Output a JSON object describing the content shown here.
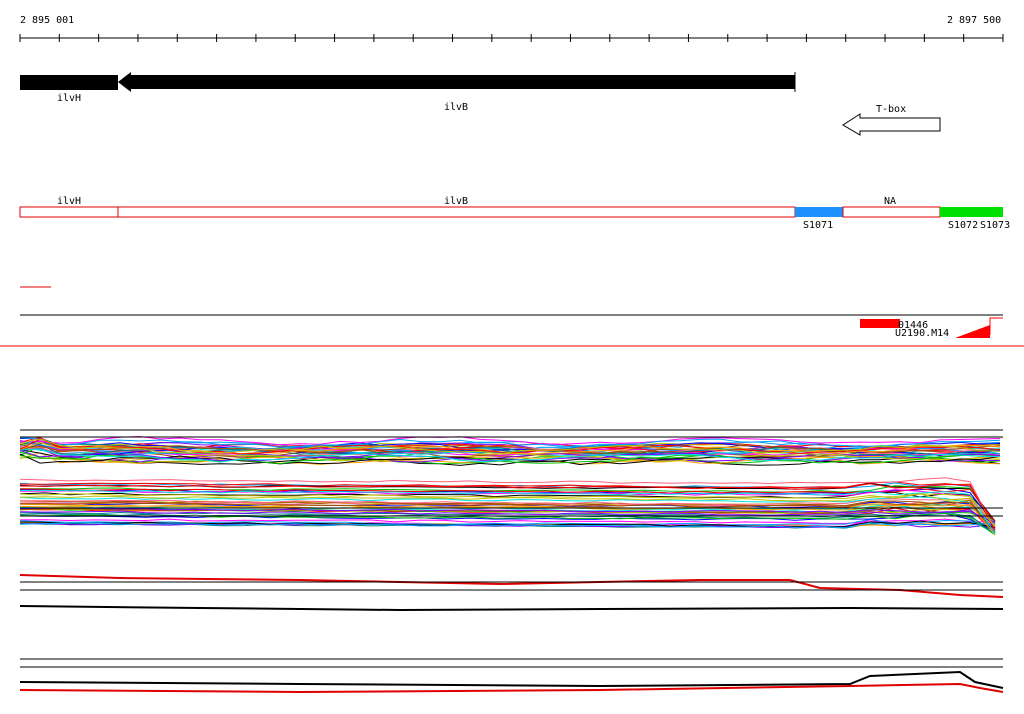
{
  "ruler": {
    "start_label": "2 895 001",
    "end_label": "2 897 500"
  },
  "genes": [
    {
      "name": "ilvH",
      "label": "ilvH",
      "strand": "-"
    },
    {
      "name": "ilvB",
      "label": "ilvB",
      "strand": "-"
    }
  ],
  "riboswitch": {
    "label": "T-box",
    "strand": "-"
  },
  "segments": [
    {
      "label": "ilvH",
      "color": "#ffffff"
    },
    {
      "label": "ilvB",
      "color": "#ffffff"
    },
    {
      "label": "",
      "color": "#1e90ff"
    },
    {
      "label": "NA",
      "color": "#ffffff"
    },
    {
      "label": "",
      "color": "#00e000"
    }
  ],
  "segment_ids": [
    "S1071",
    "S1072",
    "S1073"
  ],
  "probes": [
    {
      "label": "01446",
      "color": "#ff0000"
    },
    {
      "label": "U2190.M14",
      "color": "#ff0000"
    }
  ],
  "colors": {
    "gene": "#000000",
    "segment_outline": "#e00000",
    "baseline": "#ff0000",
    "profile_palette": [
      "#ff00ff",
      "#00a0ff",
      "#00c000",
      "#ffa000",
      "#8000ff",
      "#ff0000",
      "#00e0e0",
      "#c0c000",
      "#0000ff",
      "#ff6080",
      "#008080",
      "#a05000",
      "#000000"
    ]
  }
}
